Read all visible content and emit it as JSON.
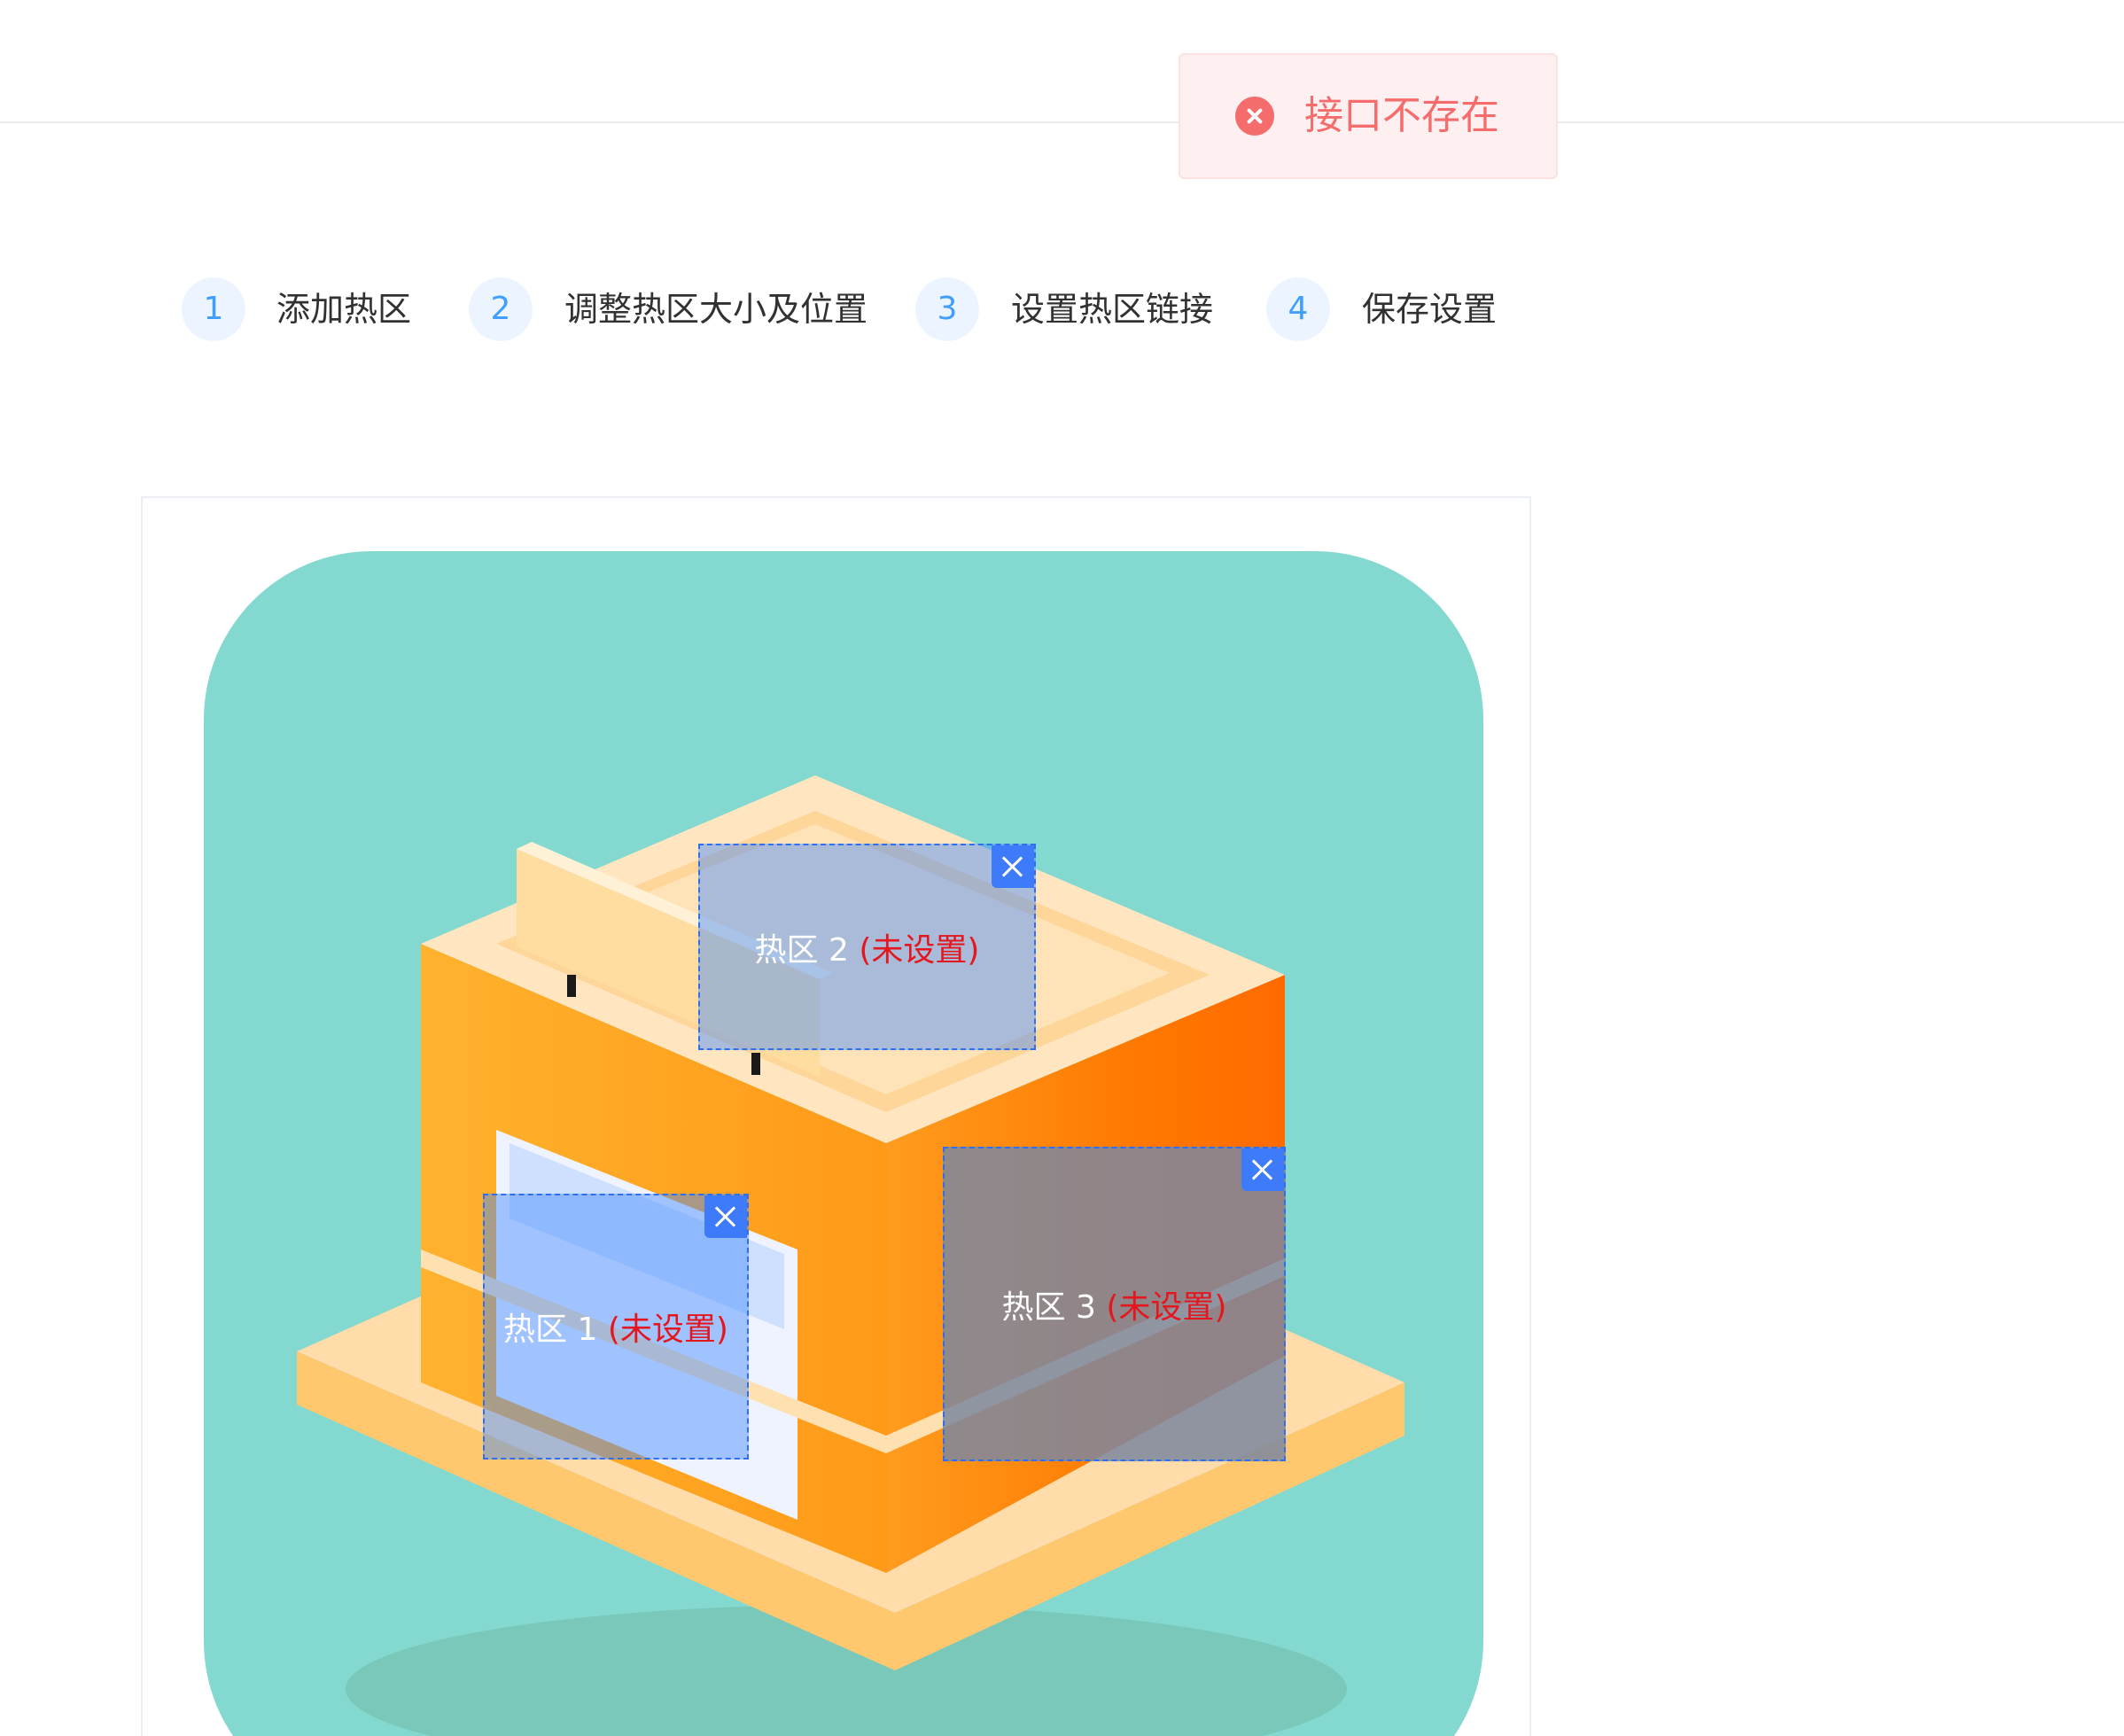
{
  "toast": {
    "type": "error",
    "icon": "error-circle-icon",
    "message": "接口不存在"
  },
  "steps": [
    {
      "number": "1",
      "label": "添加热区"
    },
    {
      "number": "2",
      "label": "调整热区大小及位置"
    },
    {
      "number": "3",
      "label": "设置热区链接"
    },
    {
      "number": "4",
      "label": "保存设置"
    }
  ],
  "hotspots": [
    {
      "title": "热区 2",
      "status": "(未设置)",
      "close_icon": "close-icon"
    },
    {
      "title": "热区 1",
      "status": "(未设置)",
      "close_icon": "close-icon"
    },
    {
      "title": "热区 3",
      "status": "(未设置)",
      "close_icon": "close-icon"
    }
  ],
  "colors": {
    "error": "#f56c6c",
    "step_accent": "#409eff",
    "hotspot_border": "#2f6fef",
    "status_red": "#e4171f"
  }
}
